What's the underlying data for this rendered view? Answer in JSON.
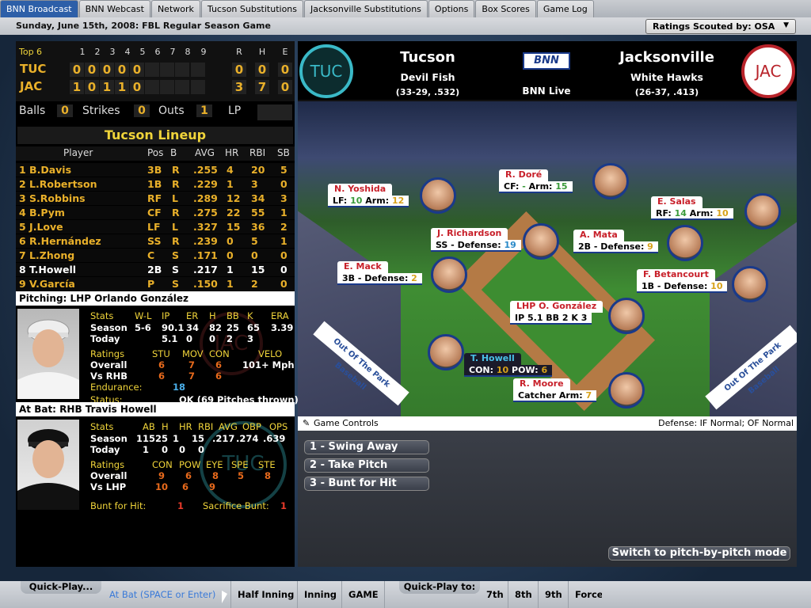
{
  "tabs": [
    {
      "label": "BNN Broadcast",
      "active": true
    },
    {
      "label": "BNN Webcast"
    },
    {
      "label": "Network"
    },
    {
      "label": "Tucson Substitutions"
    },
    {
      "label": "Jacksonville Substitutions"
    },
    {
      "label": "Options"
    },
    {
      "label": "Box Scores"
    },
    {
      "label": "Game Log"
    }
  ],
  "header": {
    "date_label": "Sunday, June 15th, 2008: FBL Regular Season Game",
    "scout_dropdown": "Ratings Scouted by: OSA"
  },
  "scoreboard": {
    "inning_label": "Top 6",
    "innings": [
      "1",
      "2",
      "3",
      "4",
      "5",
      "6",
      "7",
      "8",
      "9"
    ],
    "rhe_heads": [
      "R",
      "H",
      "E"
    ],
    "away": {
      "abbr": "TUC",
      "runs": [
        "0",
        "0",
        "0",
        "0",
        "0",
        "",
        "",
        "",
        ""
      ],
      "rhe": [
        "0",
        "0",
        "0"
      ]
    },
    "home": {
      "abbr": "JAC",
      "runs": [
        "1",
        "0",
        "1",
        "1",
        "0",
        "",
        "",
        "",
        ""
      ],
      "rhe": [
        "3",
        "7",
        "0"
      ]
    },
    "balls_label": "Balls",
    "balls": "0",
    "strikes_label": "Strikes",
    "strikes": "0",
    "outs_label": "Outs",
    "outs": "1",
    "lp_label": "LP"
  },
  "lineup": {
    "title": "Tucson Lineup",
    "headers": [
      "Player",
      "Pos",
      "B",
      "AVG",
      "HR",
      "RBI",
      "SB"
    ],
    "rows": [
      {
        "name": "1 B.Davis",
        "pos": "3B",
        "b": "R",
        "avg": ".255",
        "hr": "4",
        "rbi": "20",
        "sb": "5"
      },
      {
        "name": "2 L.Robertson",
        "pos": "1B",
        "b": "R",
        "avg": ".229",
        "hr": "1",
        "rbi": "3",
        "sb": "0"
      },
      {
        "name": "3 S.Robbins",
        "pos": "RF",
        "b": "L",
        "avg": ".289",
        "hr": "12",
        "rbi": "34",
        "sb": "3"
      },
      {
        "name": "4 B.Pym",
        "pos": "CF",
        "b": "R",
        "avg": ".275",
        "hr": "22",
        "rbi": "55",
        "sb": "1"
      },
      {
        "name": "5 J.Love",
        "pos": "LF",
        "b": "L",
        "avg": ".327",
        "hr": "15",
        "rbi": "36",
        "sb": "2"
      },
      {
        "name": "6 R.Hernández",
        "pos": "SS",
        "b": "R",
        "avg": ".239",
        "hr": "0",
        "rbi": "5",
        "sb": "1"
      },
      {
        "name": "7 L.Zhong",
        "pos": "C",
        "b": "S",
        "avg": ".171",
        "hr": "0",
        "rbi": "0",
        "sb": "0"
      },
      {
        "name": "8 T.Howell",
        "pos": "2B",
        "b": "S",
        "avg": ".217",
        "hr": "1",
        "rbi": "15",
        "sb": "0",
        "current": true
      },
      {
        "name": "9 V.García",
        "pos": "P",
        "b": "S",
        "avg": ".150",
        "hr": "1",
        "rbi": "2",
        "sb": "0"
      }
    ]
  },
  "pitcher": {
    "title": "Pitching: LHP Orlando González",
    "stats_label": "Stats",
    "stat_heads": [
      "W-L",
      "IP",
      "ER",
      "H",
      "BB",
      "K",
      "ERA"
    ],
    "season_label": "Season",
    "season": [
      "5-6",
      "90.1",
      "34",
      "82",
      "25",
      "65",
      "3.39"
    ],
    "today_label": "Today",
    "today": [
      "",
      "5.1",
      "0",
      "0",
      "2",
      "3",
      ""
    ],
    "ratings_label": "Ratings",
    "rating_heads": [
      "STU",
      "MOV",
      "CON",
      "VELO"
    ],
    "overall_label": "Overall",
    "overall": [
      "6",
      "7",
      "6",
      "101+ Mph"
    ],
    "vs_label": "Vs RHB",
    "vs": [
      "6",
      "7",
      "6"
    ],
    "endurance_label": "Endurance:",
    "endurance": "18",
    "status_label": "Status:",
    "status": "OK (69 Pitches thrown)",
    "watermark": "JAC"
  },
  "batter": {
    "title": "At Bat: RHB Travis Howell",
    "stats_label": "Stats",
    "stat_heads": [
      "AB",
      "H",
      "HR",
      "RBI",
      "AVG",
      "OBP",
      "OPS"
    ],
    "season_label": "Season",
    "season": [
      "115",
      "25",
      "1",
      "15",
      ".217",
      ".274",
      ".639"
    ],
    "today_label": "Today",
    "today": [
      "1",
      "0",
      "0",
      "0",
      "",
      "",
      ""
    ],
    "ratings_label": "Ratings",
    "rating_heads": [
      "CON",
      "POW",
      "EYE",
      "SPE",
      "STE"
    ],
    "overall_label": "Overall",
    "overall": [
      "9",
      "6",
      "8",
      "5",
      "8"
    ],
    "vs_label": "Vs LHP",
    "vs": [
      "10",
      "6",
      "9"
    ],
    "bunt_hit_label": "Bunt for Hit:",
    "bunt_hit": "1",
    "sac_bunt_label": "Sacrifice Bunt:",
    "sac_bunt": "1",
    "watermark": "TUC"
  },
  "broadcast": {
    "away_logo": "TUC",
    "away_city": "Tucson",
    "away_nick": "Devil Fish",
    "away_record": "(33-29, .532)",
    "home_logo": "JAC",
    "home_city": "Jacksonville",
    "home_nick": "White Hawks",
    "home_record": "(26-37, .413)",
    "network_logo": "BNN",
    "network_label": "BNN Live",
    "banner_left": "Out Of The Park Baseball",
    "banner_right": "Out Of The Park Baseball"
  },
  "fielders": [
    {
      "name": "N. Yoshida",
      "info_a": "LF: ",
      "val_a": "10",
      "info_b": "  Arm: ",
      "val_b": "12"
    },
    {
      "name": "R. Doré",
      "info_a": "CF: ",
      "val_a": "-",
      "info_b": "   Arm: ",
      "val_b": "15"
    },
    {
      "name": "E. Salas",
      "info_a": "RF: ",
      "val_a": "14",
      "info_b": "  Arm: ",
      "val_b": "10"
    },
    {
      "name": "J. Richardson",
      "info_a": "SS - Defense: ",
      "val_a": "19",
      "info_b": "",
      "val_b": ""
    },
    {
      "name": "A. Mata",
      "info_a": "2B - Defense: ",
      "val_a": "9",
      "info_b": "",
      "val_b": ""
    },
    {
      "name": "E. Mack",
      "info_a": "3B - Defense: ",
      "val_a": "2",
      "info_b": "",
      "val_b": ""
    },
    {
      "name": "F. Betancourt",
      "info_a": "1B - Defense: ",
      "val_a": "10",
      "info_b": "",
      "val_b": ""
    },
    {
      "name": "LHP O. González",
      "info_a": "IP 5.1  BB 2  K 3",
      "val_a": "",
      "info_b": "",
      "val_b": ""
    },
    {
      "name": "T. Howell",
      "info_a": "CON: ",
      "val_a": "10",
      "info_b": "  POW: ",
      "val_b": "6"
    },
    {
      "name": "R. Moore",
      "info_a": "Catcher Arm: ",
      "val_a": "7",
      "info_b": "",
      "val_b": ""
    }
  ],
  "controls": {
    "title": "Game Controls",
    "defense": "Defense: IF Normal; OF Normal",
    "buttons": [
      "1 - Swing Away",
      "2 - Take Pitch",
      "3 - Bunt for Hit"
    ],
    "switch_label": "Switch to pitch-by-pitch mode"
  },
  "bottom": {
    "quick_play_tab": "Quick-Play...",
    "quick_play_to_tab": "Quick-Play to:",
    "buttons": [
      "At Bat (SPACE or Enter)",
      "Half Inning",
      "Inning",
      "GAME",
      "7th",
      "8th",
      "9th",
      "Force"
    ]
  },
  "colors": {
    "accent": "#2d5fa8",
    "gold": "#e9b02a",
    "tuc": "#3ab9c7",
    "jac": "#b8232a"
  }
}
